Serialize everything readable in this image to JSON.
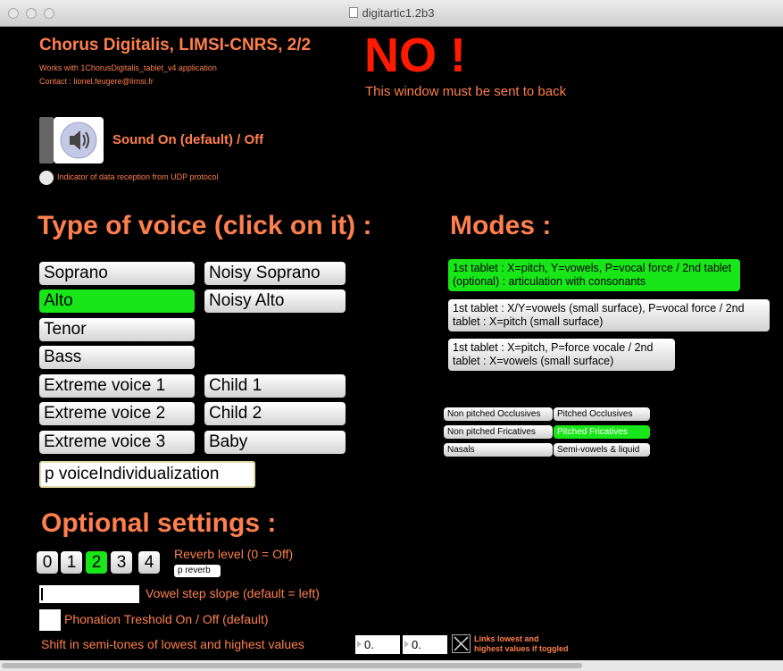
{
  "window": {
    "title": "digitartic1.2b3"
  },
  "header": {
    "title": "Chorus Digitalis, LIMSI-CNRS, 2/2",
    "line1": "Works with 1ChorusDigitalis_tablet_v4 application",
    "line2": "Contact : lionel.feugere@limsi.fr",
    "warning": "NO !",
    "warning_sub": "This window must be sent to back"
  },
  "sound": {
    "label": "Sound On (default) / Off",
    "indicator_label": "Indicator of data reception from UDP protocol"
  },
  "voice": {
    "heading": "Type of voice (click on it) :",
    "left": [
      "Soprano",
      "Alto",
      "Tenor",
      "Bass",
      "Extreme voice 1",
      "Extreme voice 2",
      "Extreme voice 3"
    ],
    "right": [
      "Noisy Soprano",
      "Noisy Alto",
      "Child 1",
      "Child 2",
      "Baby"
    ],
    "selected": "Alto",
    "individualization": "p voiceIndividualization"
  },
  "modes": {
    "heading": "Modes :",
    "items": [
      "1st tablet : X=pitch, Y=vowels, P=vocal force / 2nd tablet (optional) : articulation with consonants",
      "1st tablet : X/Y=vowels (small surface), P=vocal force / 2nd tablet : X=pitch (small surface)",
      "1st tablet : X=pitch, P=force vocale / 2nd tablet : X=vowels (small surface)"
    ],
    "selected_index": 0
  },
  "consonants": [
    "Non pitched Occlusives",
    "Pitched Occlusives",
    "Non pitched Fricatives",
    "Pitched Fricatives",
    "Nasals",
    "Semi-vowels & liquid"
  ],
  "optional": {
    "heading": "Optional settings :",
    "reverb_levels": [
      "0",
      "1",
      "2",
      "3",
      "4"
    ],
    "reverb_selected": "2",
    "reverb_label": "Reverb level (0 = Off)",
    "reverb_patch": "p reverb",
    "vowel_slope_label": "Vowel step slope (default = left)",
    "phonation_label": "Phonation Treshold On / Off (default)",
    "shift_label": "Shift in semi-tones of lowest and highest values",
    "shift_low": "0.",
    "shift_high": "0.",
    "link_label_1": "Links lowest and",
    "link_label_2": "highest values if toggled"
  },
  "colors": {
    "accent": "#ff7f4d",
    "warning": "#ff1a00",
    "selected": "#19e619"
  }
}
